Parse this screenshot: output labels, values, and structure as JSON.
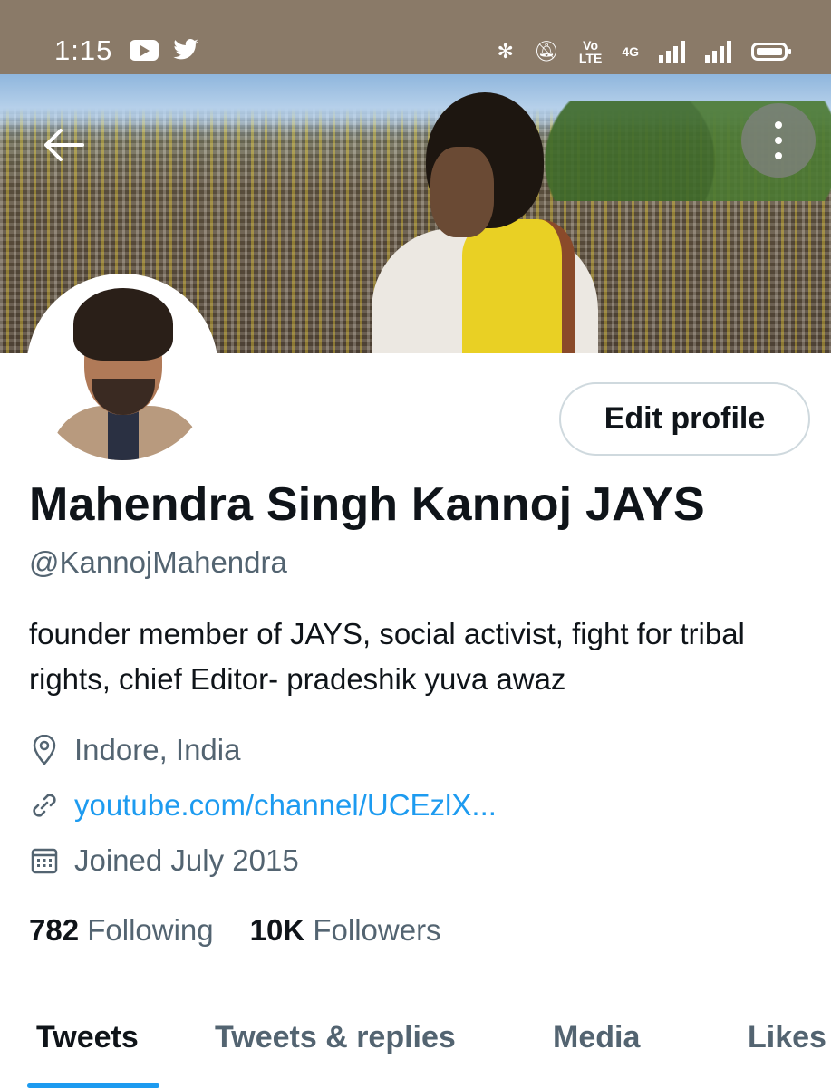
{
  "status_bar": {
    "time": "1:15",
    "network_label": "4G",
    "icons": [
      "youtube-icon",
      "twitter-icon",
      "bluetooth-icon",
      "mute-icon",
      "volte-icon",
      "signal-icon",
      "signal-icon",
      "battery-icon"
    ]
  },
  "profile": {
    "name": "Mahendra Singh Kannoj JAYS",
    "handle": "@KannojMahendra",
    "bio": "founder member of JAYS, social activist, fight for tribal rights, chief Editor- pradeshik yuva awaz",
    "location": "Indore, India",
    "website": "youtube.com/channel/UCEzlX...",
    "joined": "Joined July 2015",
    "following_count": "782",
    "following_label": "Following",
    "followers_count": "10K",
    "followers_label": "Followers"
  },
  "actions": {
    "edit_profile": "Edit profile"
  },
  "tabs": [
    {
      "label": "Tweets",
      "active": true
    },
    {
      "label": "Tweets & replies",
      "active": false
    },
    {
      "label": "Media",
      "active": false
    },
    {
      "label": "Likes",
      "active": false
    }
  ],
  "colors": {
    "accent": "#1d9bf0",
    "text_primary": "#0f1419",
    "text_secondary": "#536471",
    "status_bar": "#8a7a68"
  }
}
